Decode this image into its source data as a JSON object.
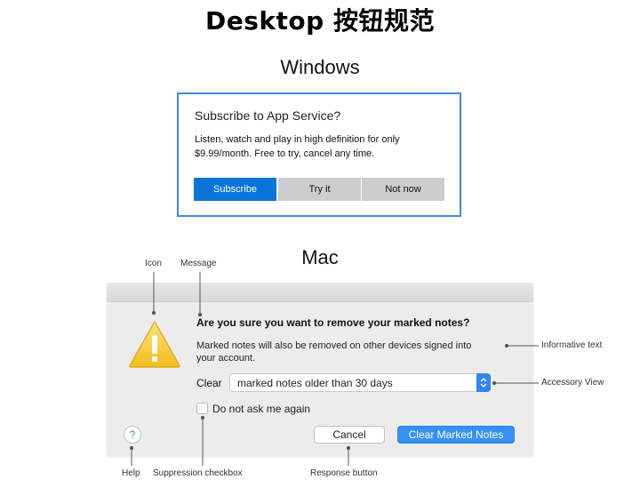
{
  "page": {
    "title": "Desktop 按钮规范"
  },
  "windows": {
    "section_label": "Windows",
    "dialog": {
      "title": "Subscribe to App Service?",
      "body_line1": "Listen, watch and play in high definition for only",
      "body_line2": "$9.99/month. Free to try, cancel any time.",
      "buttons": {
        "primary": "Subscribe",
        "secondary": "Try it",
        "tertiary": "Not now"
      },
      "accent_color": "#0a74d8",
      "border_color": "#3c8be0"
    }
  },
  "mac": {
    "section_label": "Mac",
    "dialog": {
      "message": "Are you sure you want to remove your marked notes?",
      "info_line1": "Marked notes will also be removed on other devices signed into",
      "info_line2": "your account.",
      "clear_label": "Clear",
      "select_value": "marked notes older than 30 days",
      "checkbox_label": "Do not ask me again",
      "help_symbol": "?",
      "cancel_label": "Cancel",
      "primary_label": "Clear Marked Notes",
      "accent_color": "#3591f5",
      "icon": "warning-icon"
    },
    "annotations": {
      "icon": "Icon",
      "message": "Message",
      "informative_text": "Informative text",
      "accessory_view": "Accessory View",
      "help": "Help",
      "suppression_checkbox": "Suppression checkbox",
      "response_button": "Response button"
    }
  }
}
